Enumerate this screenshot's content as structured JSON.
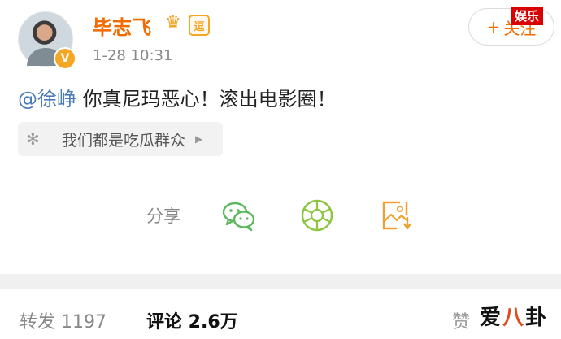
{
  "post": {
    "author": "毕志飞",
    "vip_badge": "逗",
    "verified_badge": "V",
    "timestamp": "1-28 10:31",
    "mention": "@徐峥",
    "text": " 你真尼玛恶心！滚出电影圈！",
    "source_label": "我们都是吃瓜群众",
    "follow_label": "关注",
    "follow_plus": "+"
  },
  "share": {
    "label": "分享",
    "icons": [
      "wechat-icon",
      "wechat-moments-icon",
      "save-image-icon"
    ]
  },
  "stats": {
    "repost": "转发 1197",
    "comments": "评论 2.6万",
    "like": "赞"
  },
  "overlays": {
    "ent_tag": "娱乐",
    "watermark_a": "爱",
    "watermark_b": "八",
    "watermark_c": "卦"
  },
  "colors": {
    "author": "#f26b00",
    "mention": "#4a7bb7",
    "share_green": "#5cb85c",
    "share_orange": "#f0a030"
  }
}
